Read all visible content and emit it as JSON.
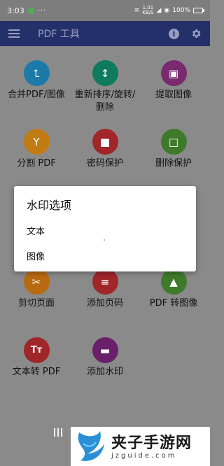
{
  "status_bar": {
    "time": "3:03",
    "overflow": "···",
    "kbs_value": "1.01",
    "kbs_unit": "KB/S",
    "battery": "100%"
  },
  "app_bar": {
    "title": "PDF 工具",
    "menu_icon": "menu-icon",
    "info_icon": "info-icon",
    "settings_icon": "gear-icon"
  },
  "tools": [
    {
      "label": "合并PDF/图像",
      "color": "#1d7aa8",
      "icon": "merge-icon",
      "glyph": "⮤"
    },
    {
      "label": "重新排序/旋转/删除",
      "color": "#0e7a5e",
      "icon": "reorder-icon",
      "glyph": "↕"
    },
    {
      "label": "提取图像",
      "color": "#7a2a6e",
      "icon": "extract-image-icon",
      "glyph": "▣"
    },
    {
      "label": "分割 PDF",
      "color": "#c27a12",
      "icon": "split-icon",
      "glyph": "Y"
    },
    {
      "label": "密码保护",
      "color": "#a0262a",
      "icon": "lock-icon",
      "glyph": "■"
    },
    {
      "label": "删除保护",
      "color": "#3f7a2a",
      "icon": "unlock-icon",
      "glyph": "□"
    },
    {
      "label": "剪切页面",
      "color": "#b86a10",
      "icon": "scissors-icon",
      "glyph": "✂"
    },
    {
      "label": "添加页码",
      "color": "#a0262a",
      "icon": "list-icon",
      "glyph": "≡"
    },
    {
      "label": "PDF 转图像",
      "color": "#3f7a2a",
      "icon": "image-icon",
      "glyph": "▲"
    },
    {
      "label": "文本转 PDF",
      "color": "#a0262a",
      "icon": "text-icon",
      "glyph": "Tт"
    },
    {
      "label": "添加水印",
      "color": "#6a1f6a",
      "icon": "watermark-icon",
      "glyph": "▬"
    }
  ],
  "dialog": {
    "title": "水印选项",
    "options": [
      "文本",
      "图像"
    ]
  },
  "watermark": {
    "title": "夹子手游网",
    "url": "jzguide.com"
  }
}
